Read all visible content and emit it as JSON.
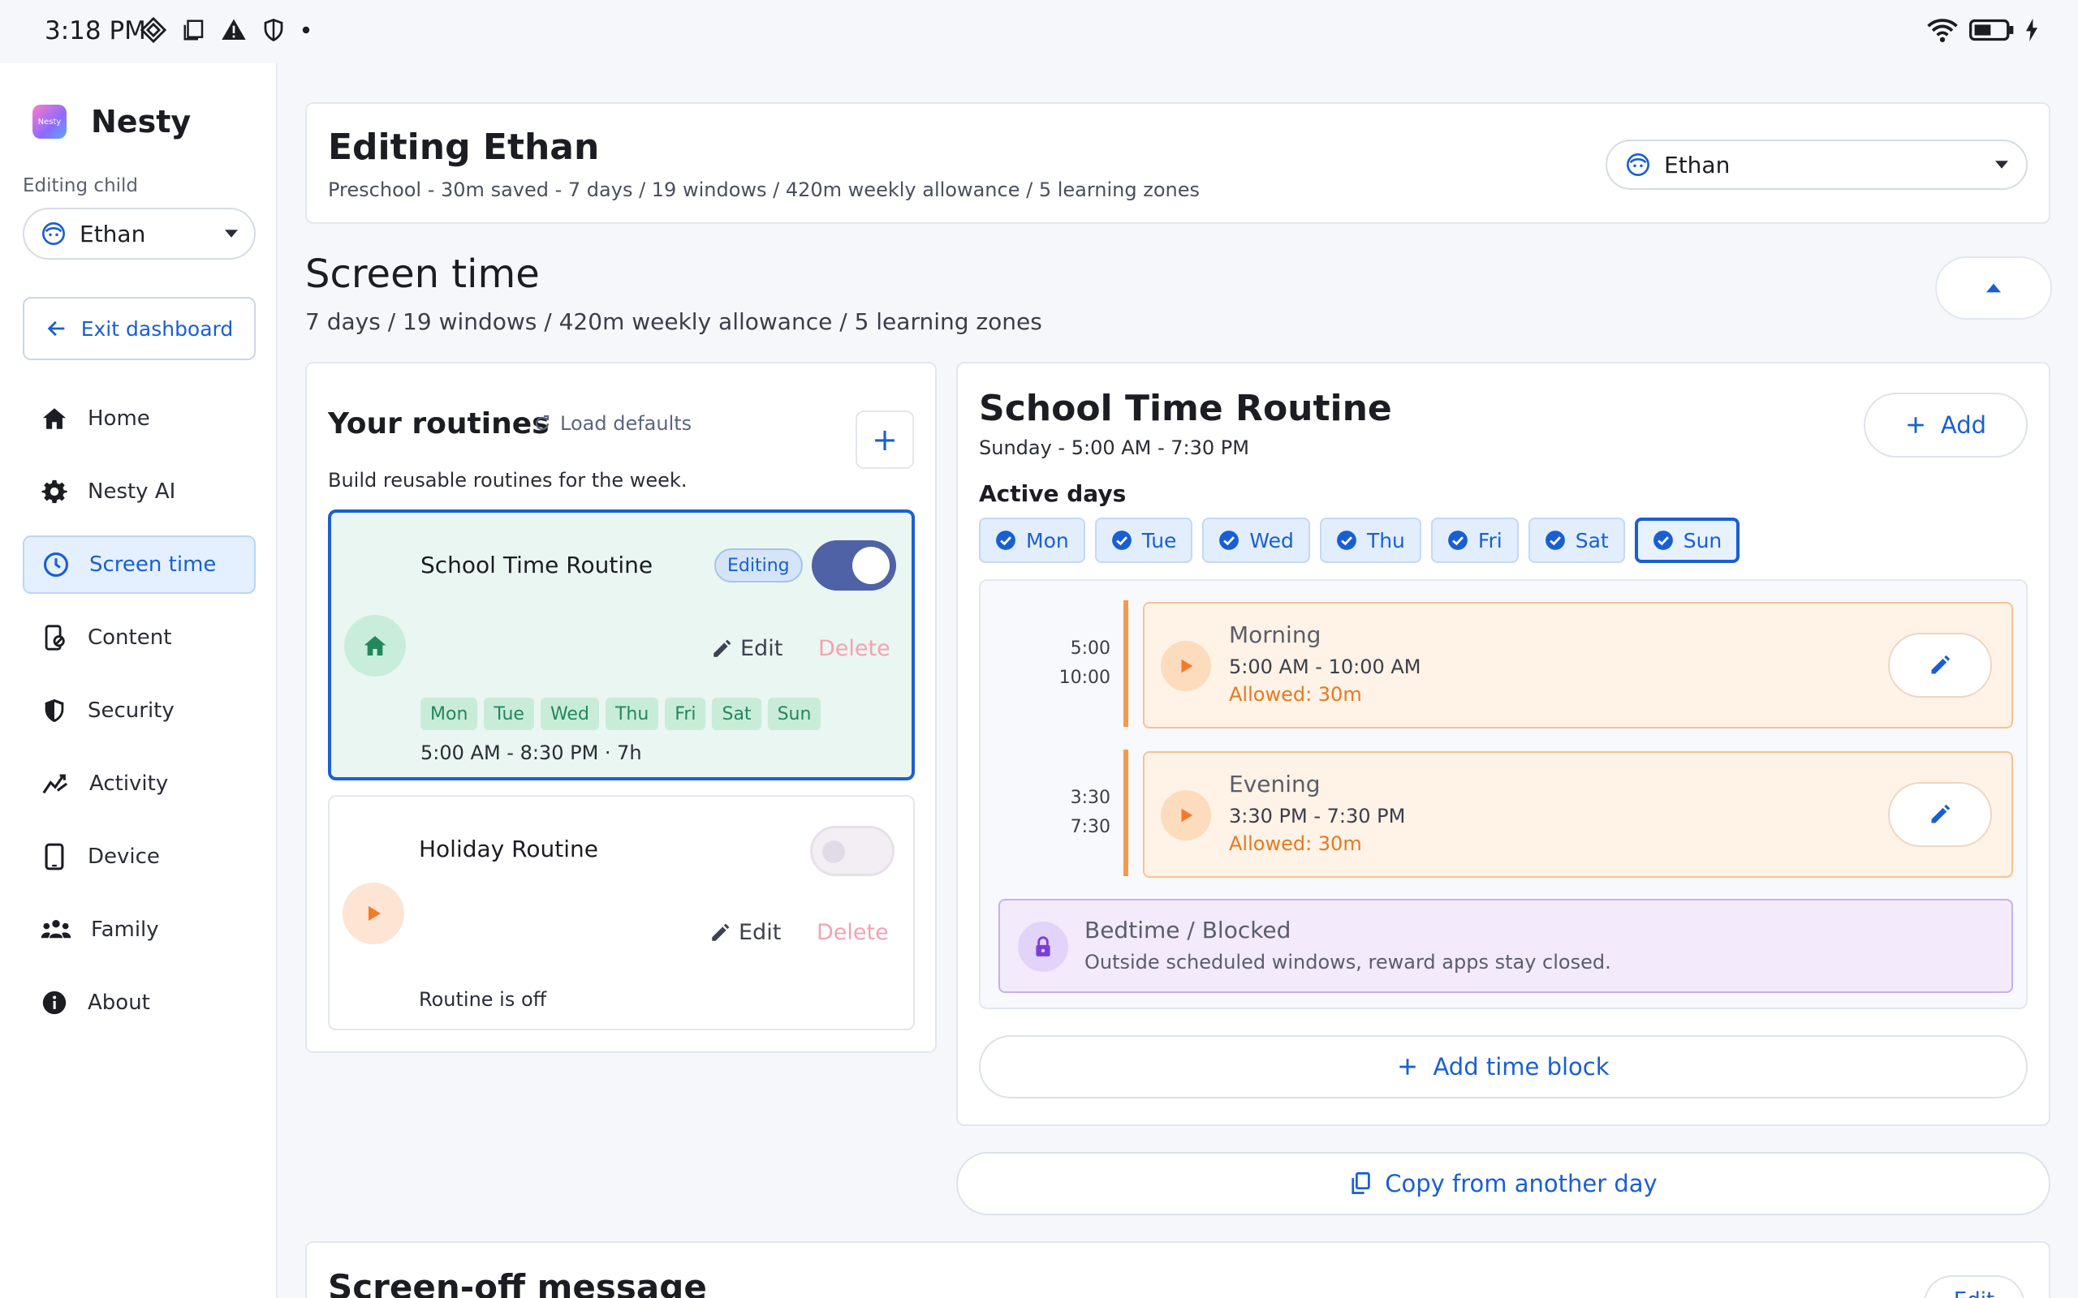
{
  "status_bar": {
    "time": "3:18 PM"
  },
  "brand": {
    "logo_text": "Nesty",
    "name": "Nesty"
  },
  "sidebar": {
    "editing_label": "Editing child",
    "child_name": "Ethan",
    "exit_label": "Exit dashboard",
    "items": [
      {
        "label": "Home",
        "icon": "home-icon"
      },
      {
        "label": "Nesty AI",
        "icon": "gear-icon"
      },
      {
        "label": "Screen time",
        "icon": "clock-icon",
        "active": true
      },
      {
        "label": "Content",
        "icon": "content-icon"
      },
      {
        "label": "Security",
        "icon": "shield-icon"
      },
      {
        "label": "Activity",
        "icon": "activity-icon"
      },
      {
        "label": "Device",
        "icon": "device-icon"
      },
      {
        "label": "Family",
        "icon": "family-icon"
      },
      {
        "label": "About",
        "icon": "info-icon"
      }
    ]
  },
  "header": {
    "title": "Editing Ethan",
    "subtitle": "Preschool - 30m saved - 7 days / 19 windows / 420m weekly allowance / 5 learning zones",
    "child_name": "Ethan"
  },
  "section": {
    "title": "Screen time",
    "subtitle": "7 days / 19 windows / 420m weekly allowance / 5 learning zones"
  },
  "routines": {
    "title": "Your routines",
    "load_defaults": "Load defaults",
    "add": "+",
    "subtitle": "Build reusable routines for the week.",
    "list": [
      {
        "name": "School Time Routine",
        "badge": "Editing",
        "enabled": true,
        "edit": "Edit",
        "delete": "Delete",
        "days": [
          "Mon",
          "Tue",
          "Wed",
          "Thu",
          "Fri",
          "Sat",
          "Sun"
        ],
        "meta": "5:00 AM - 8:30 PM · 7h"
      },
      {
        "name": "Holiday Routine",
        "enabled": false,
        "edit": "Edit",
        "delete": "Delete",
        "meta": "Routine is off"
      }
    ]
  },
  "schedule": {
    "title": "School Time Routine",
    "subtitle": "Sunday - 5:00 AM - 7:30 PM",
    "add_label": "Add",
    "active_days_label": "Active days",
    "days": [
      "Mon",
      "Tue",
      "Wed",
      "Thu",
      "Fri",
      "Sat",
      "Sun"
    ],
    "selected_day": "Sun",
    "blocks": [
      {
        "start": "5:00",
        "end": "10:00",
        "name": "Morning",
        "time": "5:00 AM - 10:00 AM",
        "allowed": "Allowed: 30m"
      },
      {
        "start": "3:30",
        "end": "7:30",
        "name": "Evening",
        "time": "3:30 PM - 7:30 PM",
        "allowed": "Allowed: 30m"
      }
    ],
    "bedtime": {
      "title": "Bedtime / Blocked",
      "subtitle": "Outside scheduled windows, reward apps stay closed."
    },
    "add_block_label": "Add time block"
  },
  "copy_label": "Copy from another day",
  "screen_off": {
    "title": "Screen-off message",
    "edit": "Edit"
  },
  "colors": {
    "accent": "#1a5fd1",
    "green": "#23875a",
    "orange": "#f39a4b",
    "purple": "#7a3fd6"
  }
}
